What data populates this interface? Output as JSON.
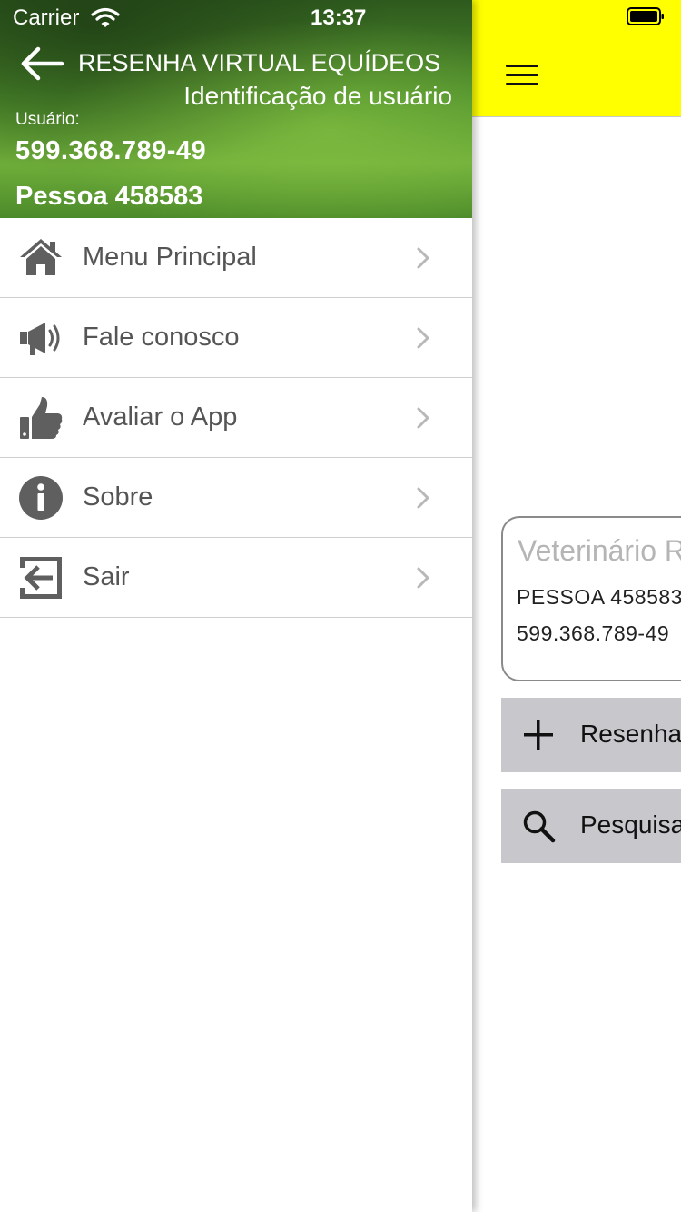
{
  "status_bar": {
    "carrier": "Carrier",
    "time": "13:37"
  },
  "header": {
    "title": "RESENHA VIRTUAL EQUÍDEOS",
    "subtitle": "Identificação de usuário",
    "user_label": "Usuário:",
    "user_id": "599.368.789-49",
    "user_name": "Pessoa 458583"
  },
  "menu": {
    "items": [
      {
        "label": "Menu Principal",
        "icon": "home-icon"
      },
      {
        "label": "Fale conosco",
        "icon": "megaphone-icon"
      },
      {
        "label": "Avaliar o App",
        "icon": "thumbs-up-icon"
      },
      {
        "label": "Sobre",
        "icon": "info-icon"
      },
      {
        "label": "Sair",
        "icon": "exit-icon"
      }
    ]
  },
  "main": {
    "card": {
      "title": "Veterinário R",
      "line1": "PESSOA 458583",
      "line2": "599.368.789-49"
    },
    "buttons": [
      {
        "label": "Resenha",
        "icon": "plus-icon"
      },
      {
        "label": "Pesquisa",
        "icon": "search-icon"
      }
    ]
  },
  "colors": {
    "main_bar": "#ffff00",
    "button_bg": "#c8c8cc",
    "menu_text": "#555555"
  }
}
